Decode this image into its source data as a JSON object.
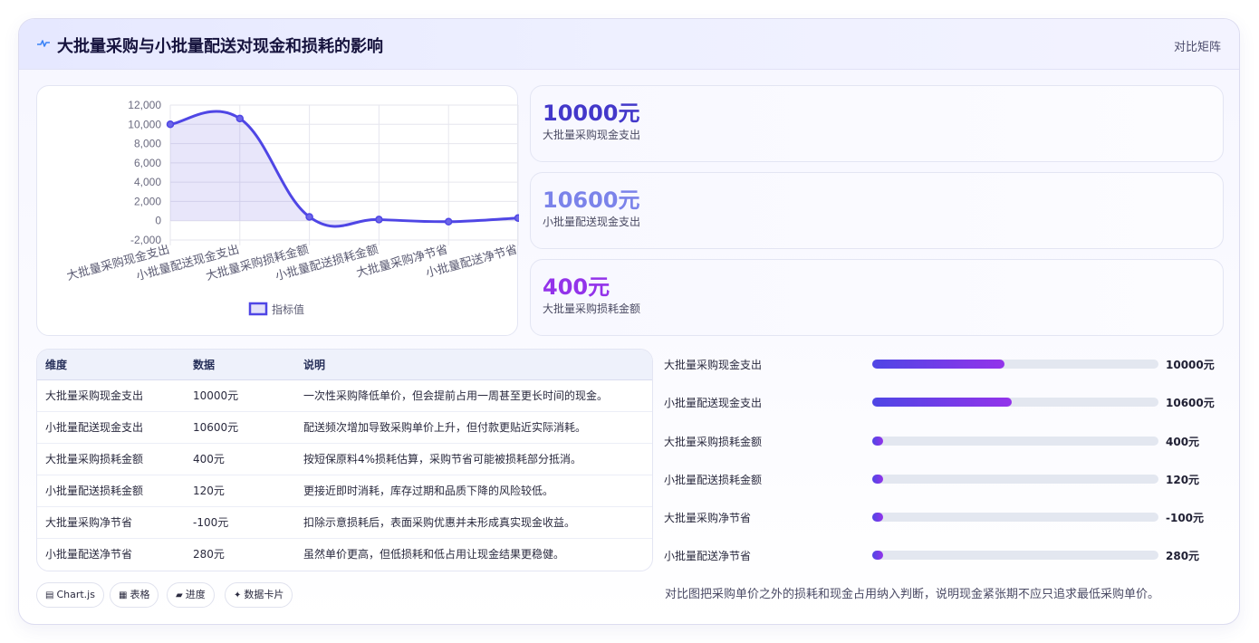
{
  "header": {
    "title": "大批量采购与小批量配送对现金和损耗的影响",
    "badge": "对比矩阵",
    "icon": "pulse-line-icon"
  },
  "chart_data": {
    "type": "line",
    "categories": [
      "大批量采购现金支出",
      "小批量配送现金支出",
      "大批量采购损耗金额",
      "小批量配送损耗金额",
      "大批量采购净节省",
      "小批量配送净节省"
    ],
    "series": [
      {
        "name": "指标值",
        "values": [
          10000,
          10600,
          400,
          120,
          -100,
          280
        ]
      }
    ],
    "ylim": [
      -2000,
      12000
    ],
    "yticks": [
      "12,000",
      "10,000",
      "8,000",
      "6,000",
      "4,000",
      "2,000",
      "0",
      "-2,000"
    ],
    "fill": true,
    "smooth": true,
    "legend": "bottom",
    "grid": true,
    "color": "#4f46e5"
  },
  "stats": [
    {
      "value": "10000元",
      "label": "大批量采购现金支出",
      "color": "#4338ca"
    },
    {
      "value": "10600元",
      "label": "小批量配送现金支出",
      "color": "#7b83ea"
    },
    {
      "value": "400元",
      "label": "大批量采购损耗金额",
      "color": "#9333ea"
    }
  ],
  "table": {
    "headers": [
      "维度",
      "数据",
      "说明"
    ],
    "rows": [
      [
        "大批量采购现金支出",
        "10000元",
        "一次性采购降低单价，但会提前占用一周甚至更长时间的现金。"
      ],
      [
        "小批量配送现金支出",
        "10600元",
        "配送频次增加导致采购单价上升，但付款更贴近实际消耗。"
      ],
      [
        "大批量采购损耗金额",
        "400元",
        "按短保原料4%损耗估算，采购节省可能被损耗部分抵消。"
      ],
      [
        "小批量配送损耗金额",
        "120元",
        "更接近即时消耗，库存过期和品质下降的风险较低。"
      ],
      [
        "大批量采购净节省",
        "-100元",
        "扣除示意损耗后，表面采购优惠并未形成真实现金收益。"
      ],
      [
        "小批量配送净节省",
        "280元",
        "虽然单价更高，但低损耗和低占用让现金结果更稳健。"
      ]
    ]
  },
  "progress": [
    {
      "label": "大批量采购现金支出",
      "value": "10000元",
      "fraction": 0.461
    },
    {
      "label": "小批量配送现金支出",
      "value": "10600元",
      "fraction": 0.488
    },
    {
      "label": "大批量采购损耗金额",
      "value": "400元",
      "fraction": 0.018
    },
    {
      "label": "小批量配送损耗金额",
      "value": "120元",
      "fraction": 0.006
    },
    {
      "label": "大批量采购净节省",
      "value": "-100元",
      "fraction": 0
    },
    {
      "label": "小批量配送净节省",
      "value": "280元",
      "fraction": 0.013
    }
  ],
  "tags": [
    {
      "icon": "▤",
      "label": "Chart.js"
    },
    {
      "icon": "▦",
      "label": "表格"
    },
    {
      "icon": "▰",
      "label": "进度"
    },
    {
      "icon": "✦",
      "label": "数据卡片"
    }
  ],
  "note": "对比图把采购单价之外的损耗和现金占用纳入判断，说明现金紧张期不应只追求最低采购单价。"
}
